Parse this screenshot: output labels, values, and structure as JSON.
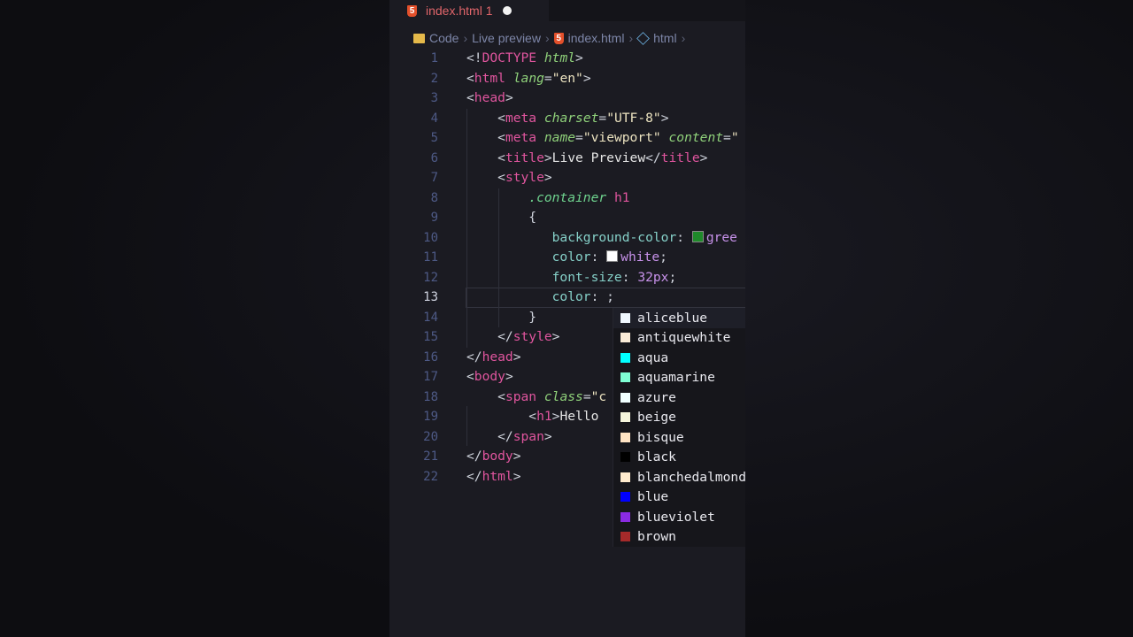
{
  "tab": {
    "title": "index.html 1"
  },
  "breadcrumb": [
    "Code",
    "Live preview",
    "index.html",
    "html"
  ],
  "code": {
    "current_line": 13,
    "lines": [
      [
        [
          "t-br",
          "<!"
        ],
        [
          "t-kw",
          "DOCTYPE"
        ],
        [
          "t-br",
          " "
        ],
        [
          "t-attr",
          "html"
        ],
        [
          "t-br",
          ">"
        ]
      ],
      [
        [
          "t-br",
          "<"
        ],
        [
          "t-tag",
          "html"
        ],
        [
          "t-br",
          " "
        ],
        [
          "t-attr",
          "lang"
        ],
        [
          "t-br",
          "="
        ],
        [
          "t-str",
          "\"en\""
        ],
        [
          "t-br",
          ">"
        ]
      ],
      [
        [
          "t-br",
          "<"
        ],
        [
          "t-tag",
          "head"
        ],
        [
          "t-br",
          ">"
        ]
      ],
      [
        [
          "t-br",
          "    <"
        ],
        [
          "t-tag",
          "meta"
        ],
        [
          "t-br",
          " "
        ],
        [
          "t-attr",
          "charset"
        ],
        [
          "t-br",
          "="
        ],
        [
          "t-str",
          "\"UTF-8\""
        ],
        [
          "t-br",
          ">"
        ]
      ],
      [
        [
          "t-br",
          "    <"
        ],
        [
          "t-tag",
          "meta"
        ],
        [
          "t-br",
          " "
        ],
        [
          "t-attr",
          "name"
        ],
        [
          "t-br",
          "="
        ],
        [
          "t-str",
          "\"viewport\""
        ],
        [
          "t-br",
          " "
        ],
        [
          "t-attr",
          "content"
        ],
        [
          "t-br",
          "="
        ],
        [
          "t-str",
          "\""
        ]
      ],
      [
        [
          "t-br",
          "    <"
        ],
        [
          "t-tag",
          "title"
        ],
        [
          "t-br",
          ">"
        ],
        [
          "t-txt",
          "Live Preview"
        ],
        [
          "t-br",
          "</"
        ],
        [
          "t-tag",
          "title"
        ],
        [
          "t-br",
          ">"
        ]
      ],
      [
        [
          "t-br",
          "    <"
        ],
        [
          "t-tag",
          "style"
        ],
        [
          "t-br",
          ">"
        ]
      ],
      [
        [
          "t-sel",
          "        .container"
        ],
        [
          "t-br",
          " "
        ],
        [
          "t-sel2",
          "h1"
        ]
      ],
      [
        [
          "t-br",
          "        {"
        ]
      ],
      [
        [
          "t-prop",
          "           background-color"
        ],
        [
          "t-br",
          ": "
        ],
        [
          "sw:#1f8a2a",
          ""
        ],
        [
          "t-val",
          "gree"
        ]
      ],
      [
        [
          "t-prop",
          "           color"
        ],
        [
          "t-br",
          ": "
        ],
        [
          "sw:#ffffff",
          ""
        ],
        [
          "t-val",
          "white"
        ],
        [
          "t-br",
          ";"
        ]
      ],
      [
        [
          "t-prop",
          "           font-size"
        ],
        [
          "t-br",
          ": "
        ],
        [
          "t-val",
          "32px"
        ],
        [
          "t-br",
          ";"
        ]
      ],
      [
        [
          "t-prop",
          "           color"
        ],
        [
          "t-br",
          ": ;"
        ]
      ],
      [
        [
          "t-br",
          "        }"
        ]
      ],
      [
        [
          "t-br",
          "    </"
        ],
        [
          "t-tag",
          "style"
        ],
        [
          "t-br",
          ">"
        ]
      ],
      [
        [
          "t-br",
          "</"
        ],
        [
          "t-tag",
          "head"
        ],
        [
          "t-br",
          ">"
        ]
      ],
      [
        [
          "t-br",
          "<"
        ],
        [
          "t-tag",
          "body"
        ],
        [
          "t-br",
          ">"
        ]
      ],
      [
        [
          "t-br",
          "    <"
        ],
        [
          "t-tag",
          "span"
        ],
        [
          "t-br",
          " "
        ],
        [
          "t-attr",
          "class"
        ],
        [
          "t-br",
          "="
        ],
        [
          "t-str",
          "\"c"
        ]
      ],
      [
        [
          "t-br",
          "        <"
        ],
        [
          "t-tag",
          "h1"
        ],
        [
          "t-br",
          ">"
        ],
        [
          "t-txt",
          "Hello"
        ]
      ],
      [
        [
          "t-br",
          "    </"
        ],
        [
          "t-tag",
          "span"
        ],
        [
          "t-br",
          ">"
        ]
      ],
      [
        [
          "t-br",
          "</"
        ],
        [
          "t-tag",
          "body"
        ],
        [
          "t-br",
          ">"
        ]
      ],
      [
        [
          "t-br",
          "</"
        ],
        [
          "t-tag",
          "html"
        ],
        [
          "t-br",
          ">"
        ]
      ]
    ]
  },
  "suggestions": [
    {
      "label": "aliceblue",
      "color": "#f0f8ff"
    },
    {
      "label": "antiquewhite",
      "color": "#faebd7"
    },
    {
      "label": "aqua",
      "color": "#00ffff"
    },
    {
      "label": "aquamarine",
      "color": "#7fffd4"
    },
    {
      "label": "azure",
      "color": "#f0ffff"
    },
    {
      "label": "beige",
      "color": "#f5f5dc"
    },
    {
      "label": "bisque",
      "color": "#ffe4c4"
    },
    {
      "label": "black",
      "color": "#000000"
    },
    {
      "label": "blanchedalmond",
      "color": "#ffebcd"
    },
    {
      "label": "blue",
      "color": "#0000ff"
    },
    {
      "label": "blueviolet",
      "color": "#8a2be2"
    },
    {
      "label": "brown",
      "color": "#a52a2a"
    }
  ]
}
